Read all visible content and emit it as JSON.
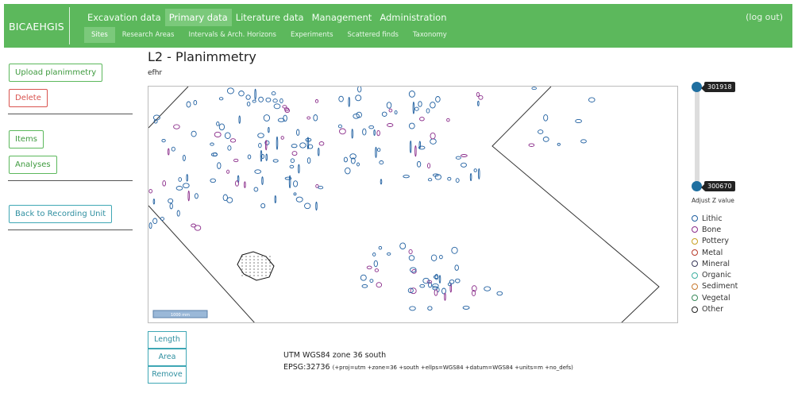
{
  "app": {
    "brand": "BICAEHGIS",
    "logout": "(log out)"
  },
  "nav": {
    "top": [
      "Excavation data",
      "Primary data",
      "Literature data",
      "Management",
      "Administration"
    ],
    "top_active": "Primary data",
    "sub": [
      "Sites",
      "Research Areas",
      "Intervals & Arch. Horizons",
      "Experiments",
      "Scattered finds",
      "Taxonomy"
    ],
    "sub_active": "Sites"
  },
  "sidebar": {
    "upload": "Upload planimmetry",
    "delete": "Delete",
    "items": "Items",
    "analyses": "Analyses",
    "back": "Back to Recording Unit"
  },
  "page": {
    "title": "L2 - Planimmetry",
    "subtitle": "efhr"
  },
  "map": {
    "scale_label": "1000 mm"
  },
  "zslider": {
    "max_value": "301918",
    "min_value": "300670",
    "label": "Adjust Z value"
  },
  "legend": [
    {
      "label": "Lithic",
      "color": "#1f5fa0"
    },
    {
      "label": "Bone",
      "color": "#8a2c8a"
    },
    {
      "label": "Pottery",
      "color": "#c8a020"
    },
    {
      "label": "Metal",
      "color": "#b83a2a"
    },
    {
      "label": "Mineral",
      "color": "#3a3a5a"
    },
    {
      "label": "Organic",
      "color": "#3fb0a0"
    },
    {
      "label": "Sediment",
      "color": "#c87a30"
    },
    {
      "label": "Vegetal",
      "color": "#3a8a5a"
    },
    {
      "label": "Other",
      "color": "#222222"
    }
  ],
  "tools": {
    "length": "Length",
    "area": "Area",
    "remove": "Remove"
  },
  "projection": {
    "name": "UTM WGS84 zone 36 south",
    "epsg": "EPSG:32736",
    "proj4": "(+proj=utm +zone=36 +south +ellps=WGS84 +datum=WGS84 +units=m +no_defs)"
  }
}
